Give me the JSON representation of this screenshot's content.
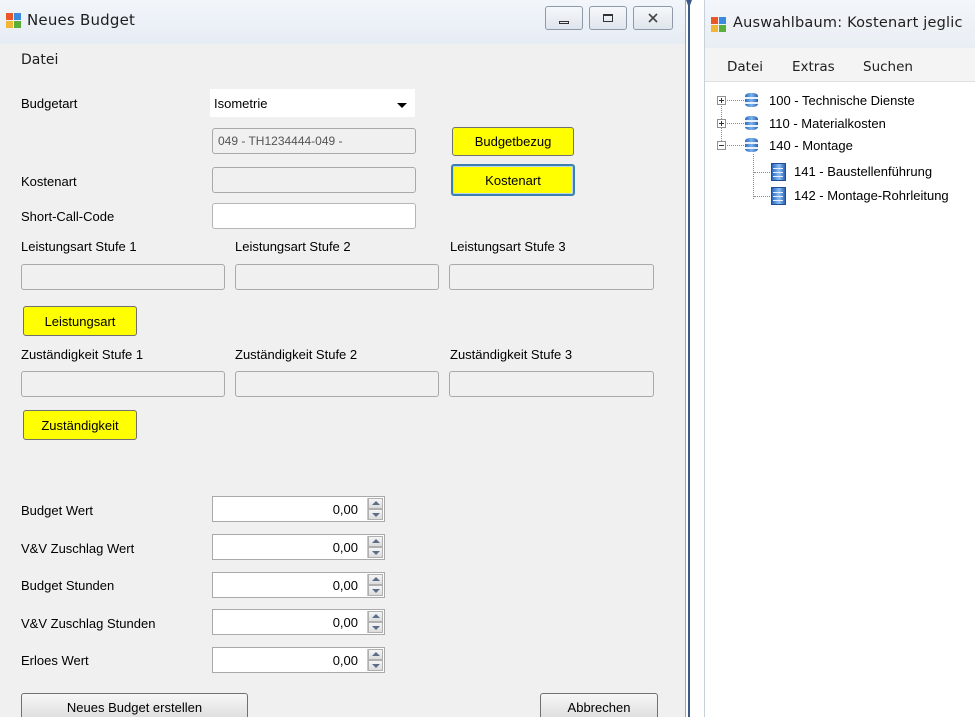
{
  "left_window": {
    "title": "Neues Budget",
    "menu": [
      "Datei"
    ],
    "budgetart_label": "Budgetart",
    "budgetart_value": "Isometrie",
    "budgetbezug_value": "049 - TH1234444-049 -",
    "budgetbezug_button": "Budgetbezug",
    "kostenart_label": "Kostenart",
    "kostenart_value": "",
    "kostenart_button": "Kostenart",
    "shortcall_label": "Short-Call-Code",
    "shortcall_value": "",
    "leistungsart": {
      "labels": [
        "Leistungsart Stufe 1",
        "Leistungsart Stufe 2",
        "Leistungsart Stufe 3"
      ],
      "values": [
        "",
        "",
        ""
      ],
      "button": "Leistungsart"
    },
    "zustaendigkeit": {
      "labels": [
        "Zuständigkeit Stufe 1",
        "Zuständigkeit Stufe 2",
        "Zuständigkeit Stufe 3"
      ],
      "values": [
        "",
        "",
        ""
      ],
      "button": "Zuständigkeit"
    },
    "numeric_fields": [
      {
        "label": "Budget Wert",
        "value": "0,00"
      },
      {
        "label": "V&V Zuschlag Wert",
        "value": "0,00"
      },
      {
        "label": "Budget Stunden",
        "value": "0,00"
      },
      {
        "label": "V&V Zuschlag Stunden",
        "value": "0,00"
      },
      {
        "label": "Erloes Wert",
        "value": "0,00"
      }
    ],
    "create_button": "Neues Budget erstellen",
    "cancel_button": "Abbrechen"
  },
  "right_window": {
    "title": "Auswahlbaum: Kostenart jeglic",
    "menu": [
      "Datei",
      "Extras",
      "Suchen"
    ],
    "tree": [
      {
        "label": "100 - Technische Dienste",
        "level": 0,
        "state": "collapsed"
      },
      {
        "label": "110 - Materialkosten",
        "level": 0,
        "state": "collapsed"
      },
      {
        "label": "140 - Montage",
        "level": 0,
        "state": "expanded"
      },
      {
        "label": "141 - Baustellenführung",
        "level": 1,
        "state": "leaf"
      },
      {
        "label": "142 - Montage-Rohrleitung",
        "level": 1,
        "state": "leaf"
      }
    ]
  },
  "colors": {
    "accent_button": "#ffff00",
    "focus_border": "#3c7fb1",
    "window_bg": "#f0f0f0"
  }
}
